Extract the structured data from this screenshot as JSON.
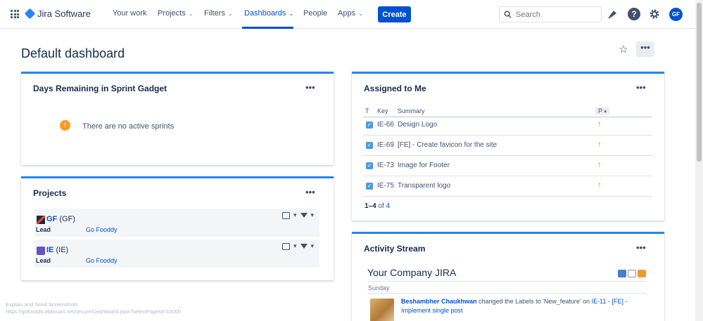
{
  "header": {
    "app_name": "Jira Software",
    "nav": [
      {
        "label": "Your work",
        "has_chevron": false
      },
      {
        "label": "Projects",
        "has_chevron": true
      },
      {
        "label": "Filters",
        "has_chevron": true
      },
      {
        "label": "Dashboards",
        "has_chevron": true,
        "active": true
      },
      {
        "label": "People",
        "has_chevron": false
      },
      {
        "label": "Apps",
        "has_chevron": true
      }
    ],
    "create_label": "Create",
    "search_placeholder": "Search",
    "avatar_initials": "GF",
    "icons": [
      "app-switcher-icon",
      "search-icon",
      "notification-icon",
      "help-icon",
      "settings-icon"
    ]
  },
  "page": {
    "title": "Default dashboard",
    "more_label": "•••"
  },
  "sprint_gadget": {
    "title": "Days Remaining in Sprint Gadget",
    "message": "There are no active sprints"
  },
  "projects_gadget": {
    "title": "Projects",
    "lead_label": "Lead",
    "items": [
      {
        "key": "GF",
        "suffix": "(GF)",
        "lead": "Go Fooddy"
      },
      {
        "key": "IE",
        "suffix": "(IE)",
        "lead": "Go Fooddy"
      }
    ]
  },
  "assigned_gadget": {
    "title": "Assigned to Me",
    "columns": {
      "type": "T",
      "key": "Key",
      "summary": "Summary",
      "priority": "P"
    },
    "rows": [
      {
        "key": "IE-66",
        "summary": "Design Logo"
      },
      {
        "key": "IE-69",
        "summary": "[FE] - Create favicon for the site"
      },
      {
        "key": "IE-73",
        "summary": "Image for Footer"
      },
      {
        "key": "IE-75",
        "summary": "Transparent logo"
      }
    ],
    "paging_range": "1–4",
    "paging_of": "of",
    "paging_total": "4"
  },
  "activity_gadget": {
    "title": "Activity Stream",
    "stream_title": "Your Company JIRA",
    "day": "Sunday",
    "entry": {
      "user": "Beshambher Chaukhwan",
      "action": "changed the Labels to 'New_feature' on",
      "issue": "IE-11 - [FE] - Implement single post"
    }
  },
  "footer": {
    "line1": "Explain and Send Screenshots",
    "line2": "https://gofooddy.atlassian.net/secure/Dashboard.jspa?selectPageId=10000"
  },
  "colors": {
    "brand": "#0052cc",
    "gadget_accent": "#2684ff",
    "priority_arrow": "#ff7a00",
    "warning": "#ff991f"
  }
}
